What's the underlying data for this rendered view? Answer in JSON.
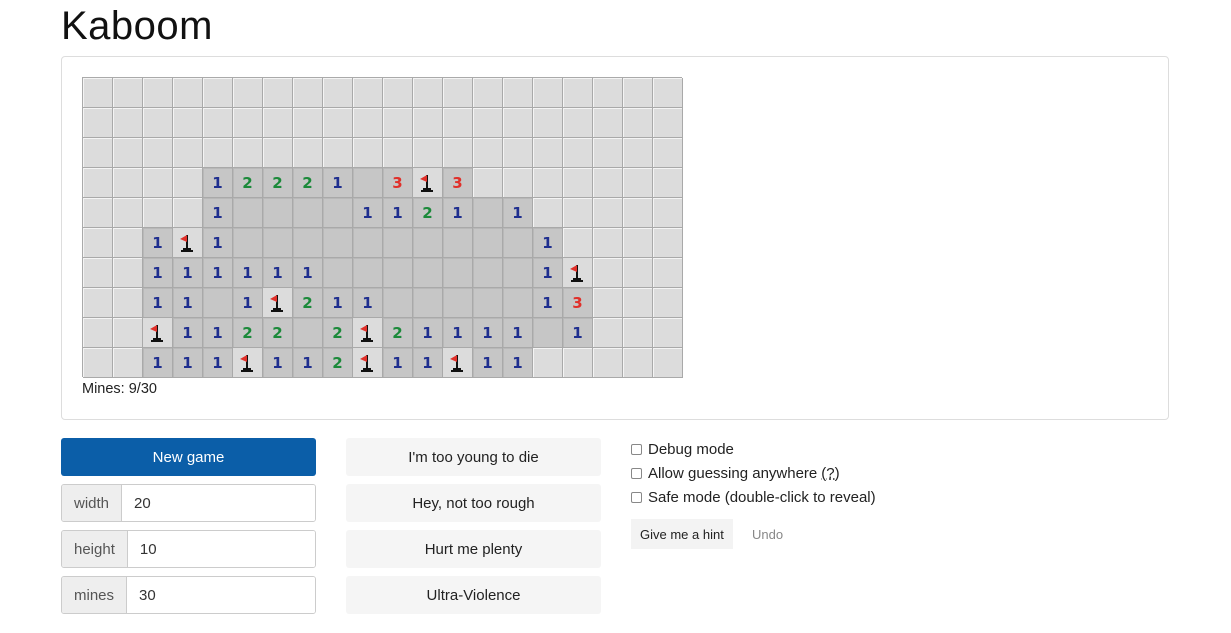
{
  "title": "Kaboom",
  "status": "Mines: 9/30",
  "board": {
    "cols": 20,
    "rows": 10,
    "grid": [
      "....................",
      "....................",
      "....................",
      "....12221 3F3.......",
      "....1    1121 1.....",
      "..1F1          1....",
      "..111111       1F...",
      "..11 1F211     13...",
      "..F1122 2F21111 1...",
      "..111F112F11F11....."
    ]
  },
  "buttons": {
    "new_game": "New game",
    "hint": "Give me a hint",
    "undo": "Undo"
  },
  "fields": [
    {
      "label": "width",
      "value": "20"
    },
    {
      "label": "height",
      "value": "10"
    },
    {
      "label": "mines",
      "value": "30"
    }
  ],
  "difficulties": [
    "I'm too young to die",
    "Hey, not too rough",
    "Hurt me plenty",
    "Ultra-Violence"
  ],
  "options": {
    "debug": {
      "label": "Debug mode",
      "checked": false
    },
    "guessing": {
      "label": "Allow guessing anywhere",
      "help": "(?)",
      "checked": false
    },
    "safe": {
      "label": "Safe mode (double-click to reveal)",
      "checked": false
    }
  },
  "colors": {
    "accent": "#0b5ea8",
    "one": "#1f2f8f",
    "two": "#1b8a3a",
    "three": "#e0302a"
  }
}
